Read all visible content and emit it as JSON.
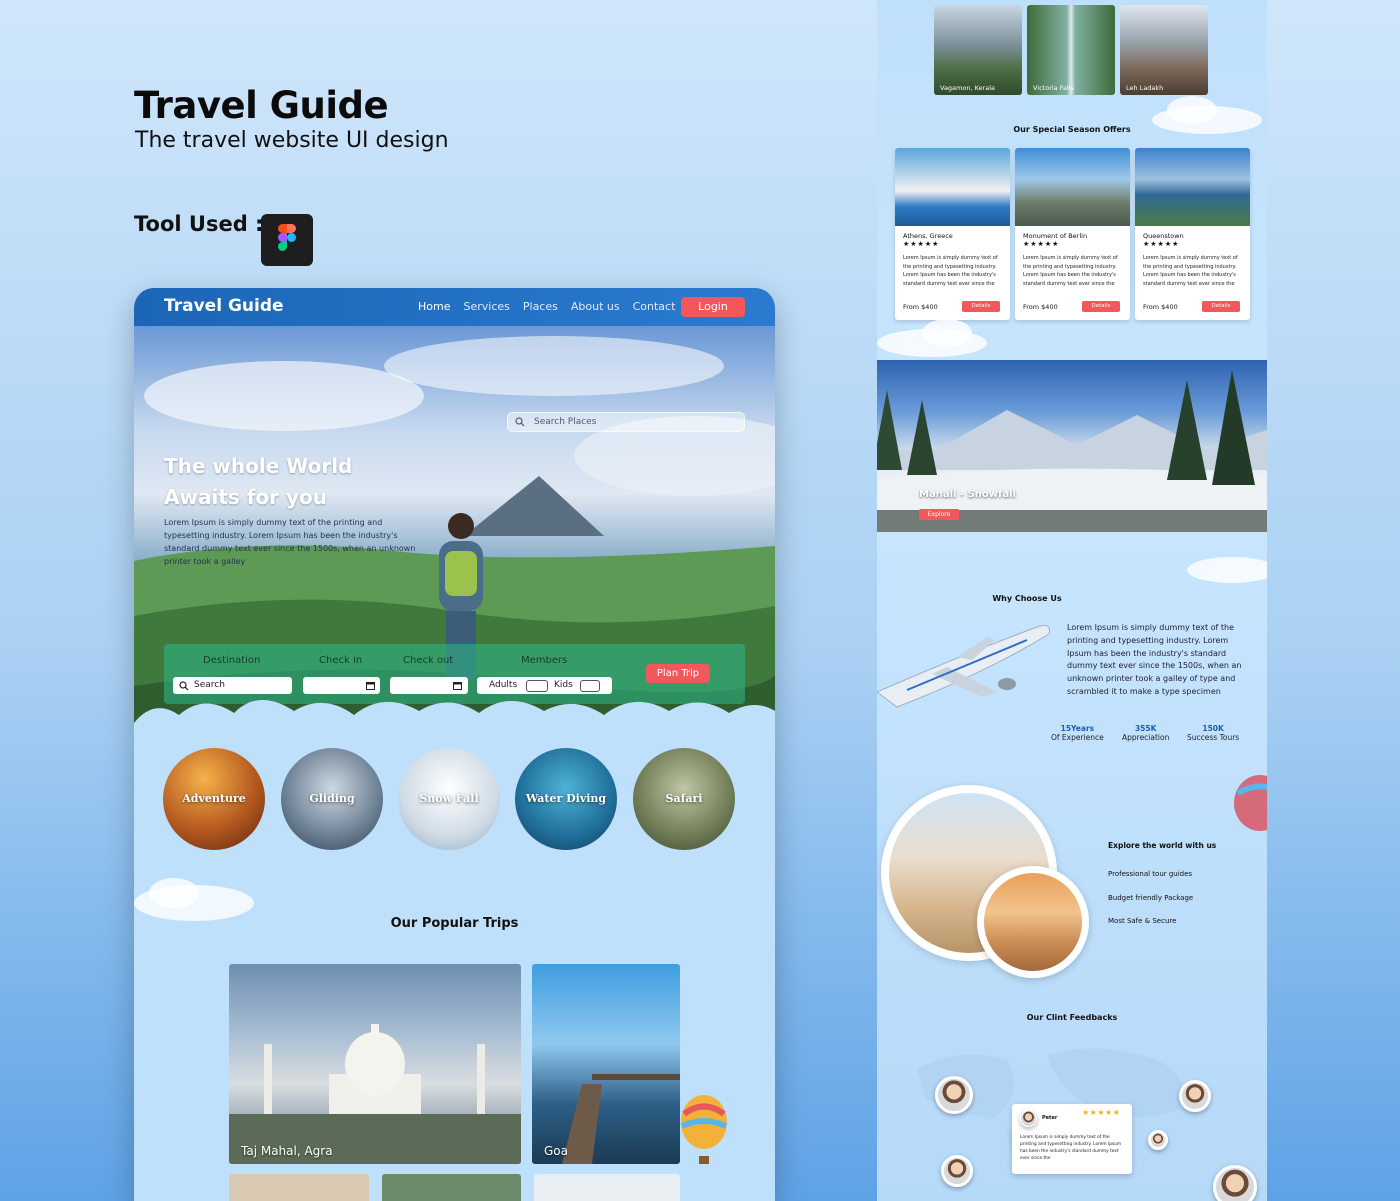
{
  "page": {
    "title": "Travel Guide",
    "subtitle": "The travel website UI design",
    "tool_label": "Tool Used :"
  },
  "colors": {
    "primary": "#1c66b8",
    "accent": "#f2575b",
    "bg": "#bfe0fb"
  },
  "nav": {
    "brand": "Travel Guide",
    "links": [
      "Home",
      "Services",
      "Places",
      "About us",
      "Contact"
    ],
    "login": "Login"
  },
  "hero": {
    "line1": "The whole World",
    "line2": "Awaits for you",
    "desc": "Lorem Ipsum is simply dummy text of the printing and typesetting industry. Lorem Ipsum has been the industry's standard dummy text ever since the 1500s, when an unknown printer took a galley",
    "search_placeholder": "Search Places"
  },
  "booking": {
    "destination": "Destination",
    "checkin": "Check in",
    "checkout": "Check out",
    "members": "Members",
    "search": "Search",
    "adults": "Adults",
    "kids": "Kids",
    "plan": "Plan Trip"
  },
  "categories": [
    "Adventure",
    "Gliding",
    "Snow Fall",
    "Water Diving",
    "Safari"
  ],
  "popular": {
    "title": "Our Popular Trips",
    "trips": [
      "Taj Mahal, Agra",
      "Goa"
    ]
  },
  "right": {
    "thumbs": [
      "Vagamon, Kerala",
      "Victoria Falls",
      "Leh Ladakh"
    ],
    "offers_title": "Our Special Season Offers",
    "offers": [
      {
        "name": "Athens, Greece",
        "stars": "★★★★★",
        "desc": "Lorem Ipsum is simply dummy text of the printing and typesetting industry. Lorem Ipsum has been the industry's standard dummy text ever since the",
        "price": "From $400",
        "btn": "Details"
      },
      {
        "name": "Monument of Berlin",
        "stars": "★★★★★",
        "desc": "Lorem Ipsum is simply dummy text of the printing and typesetting industry. Lorem Ipsum has been the industry's standard dummy text ever since the",
        "price": "From $400",
        "btn": "Details"
      },
      {
        "name": "Queenstown",
        "stars": "★★★★★",
        "desc": "Lorem Ipsum is simply dummy text of the printing and typesetting industry. Lorem Ipsum has been the industry's standard dummy text ever since the",
        "price": "From $400",
        "btn": "Details"
      }
    ],
    "banner": {
      "title": "Manali - Snowfall",
      "btn": "Explore"
    },
    "why_title": "Why Choose Us",
    "why_text": "Lorem Ipsum is simply dummy text of the printing and typesetting industry. Lorem Ipsum has been the industry's standard dummy text ever since the 1500s, when an unknown printer took a galley of type and scrambled it to make a type specimen",
    "stats": [
      {
        "value": "15Years",
        "label": "Of Experience"
      },
      {
        "value": "355K",
        "label": "Appreciation"
      },
      {
        "value": "150K",
        "label": "Success Tours"
      }
    ],
    "explore": {
      "title": "Explore the world with us",
      "items": [
        "Professional tour guides",
        "Budget friendly Package",
        "Most Safe & Secure"
      ]
    },
    "feedback_title": "Our Clint Feedbacks",
    "feedback": {
      "name": "Peter",
      "stars": "★★★★★",
      "text": "Lorem Ipsum is simply dummy text of the printing and typesetting industry. Lorem Ipsum has been the industry's standard dummy text ever since the"
    }
  }
}
